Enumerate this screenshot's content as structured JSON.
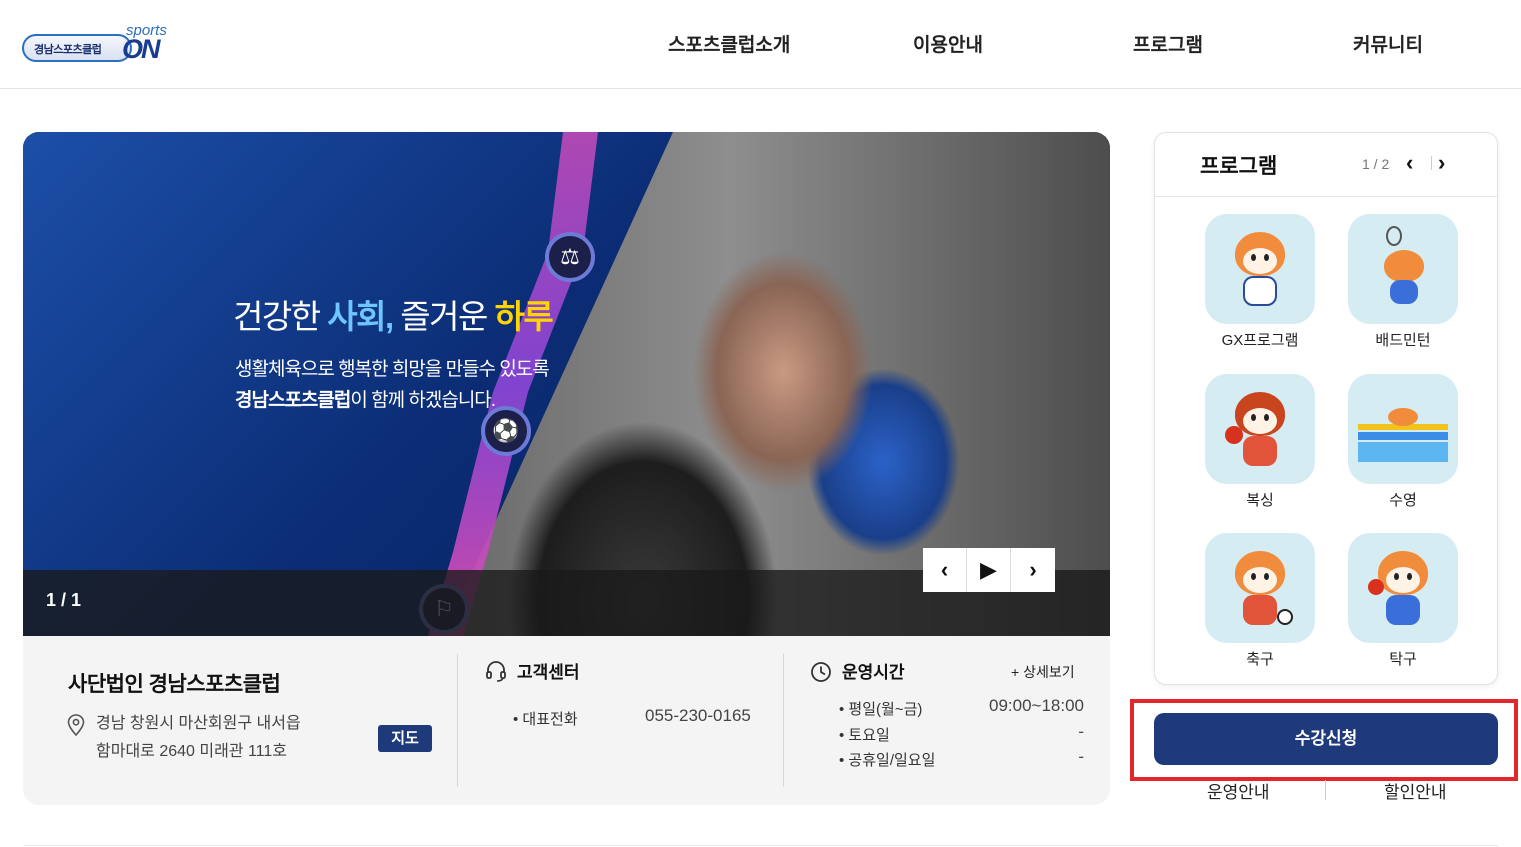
{
  "header": {
    "logo": {
      "brand_text": "경남스포츠클럽",
      "sports_text": "sports",
      "on_text": "ON"
    },
    "nav": [
      {
        "label": "스포츠클럽소개"
      },
      {
        "label": "이용안내"
      },
      {
        "label": "프로그램"
      },
      {
        "label": "커뮤니티"
      }
    ]
  },
  "hero": {
    "title_part1": "건강한 ",
    "title_highlight1": "사회,",
    "title_part2": " 즐거운 ",
    "title_highlight2": "하루",
    "subtitle_line1": "생활체육으로 행복한 희망을 만들수 있도록",
    "subtitle_line2_bold": "경남스포츠클럽",
    "subtitle_line2_rest": "이 함께 하겠습니다.",
    "counter": "1 / 1",
    "controls": {
      "prev": "‹",
      "play": "▶",
      "next": "›"
    },
    "accent_colors": {
      "blue": "#6fc6ff",
      "yellow": "#ffd400"
    }
  },
  "info": {
    "org_name": "사단법인 경남스포츠클럽",
    "address_line1": "경남 창원시 마산회원구 내서읍",
    "address_line2": "함마대로 2640 미래관 111호",
    "map_button": "지도",
    "customer_center": {
      "title": "고객센터",
      "label": "• 대표전화",
      "phone": "055-230-0165"
    },
    "hours": {
      "title": "운영시간",
      "more_label": "+ 상세보기",
      "rows": [
        {
          "label": "• 평일(월~금)",
          "value": "09:00~18:00"
        },
        {
          "label": "• 토요일",
          "value": "-"
        },
        {
          "label": "• 공휴일/일요일",
          "value": "-"
        }
      ]
    }
  },
  "programs": {
    "title": "프로그램",
    "page": "1 / 2",
    "prev": "‹",
    "next": "›",
    "items": [
      {
        "label": "GX프로그램"
      },
      {
        "label": "배드민턴"
      },
      {
        "label": "복싱"
      },
      {
        "label": "수영"
      },
      {
        "label": "축구"
      },
      {
        "label": "탁구"
      }
    ]
  },
  "cta": {
    "apply_label": "수강신청",
    "links": [
      {
        "label": "운영안내"
      },
      {
        "label": "할인안내"
      }
    ]
  },
  "colors": {
    "brand_navy": "#1f3a7a",
    "highlight_red": "#e3262b"
  }
}
